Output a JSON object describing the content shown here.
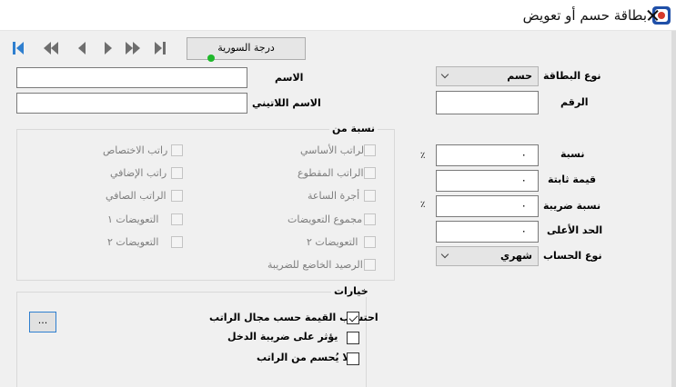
{
  "window": {
    "title": "بطاقة حسم أو تعويض",
    "icon": "app-logo-icon"
  },
  "toolbar": {
    "nav": [
      "first-record-icon",
      "previous-page-icon",
      "previous-record-icon",
      "next-record-icon",
      "next-page-icon",
      "last-record-icon"
    ],
    "syria_grade_label": "درجة السورية"
  },
  "fields": {
    "name_label": "الاسم",
    "name_value": "",
    "latin_name_label": "الاسم اللاتيني",
    "latin_name_value": "",
    "card_type_label": "نوع البطاقة",
    "card_type_value": "حسم",
    "number_label": "الرقم",
    "number_value": ""
  },
  "amounts": {
    "percent_label": "نسبة",
    "percent_value": "٠",
    "percent_unit": "٪",
    "fixed_value_label": "قيمة ثابتة",
    "fixed_value_value": "٠",
    "tax_rate_label": "نسبة ضريبة",
    "tax_rate_value": "٠",
    "tax_rate_unit": "٪",
    "max_label": "الحد الأعلى",
    "max_value": "٠",
    "calc_type_label": "نوع الحساب",
    "calc_type_value": "شهري"
  },
  "percent_of": {
    "title": "نسبة من",
    "right_column": [
      "الراتب الأساسي",
      "الراتب المقطوع",
      "أجرة الساعة",
      "مجموع التعويضات",
      "التعويضات ٢",
      "الرصيد الخاضع للضريبة"
    ],
    "left_column": [
      "راتب الاختصاص",
      "راتب الإضافي",
      "الراتب الصافي",
      "التعويضات ١",
      "التعويضات ٢"
    ]
  },
  "options": {
    "title": "خيارات",
    "items": [
      {
        "label": "احتساب القيمة حسب مجال الراتب",
        "checked": true
      },
      {
        "label": "يؤثر على ضريبة الدخل",
        "checked": false
      },
      {
        "label": "لا يُحسم من الراتب",
        "checked": false
      }
    ],
    "browse_label": "..."
  }
}
